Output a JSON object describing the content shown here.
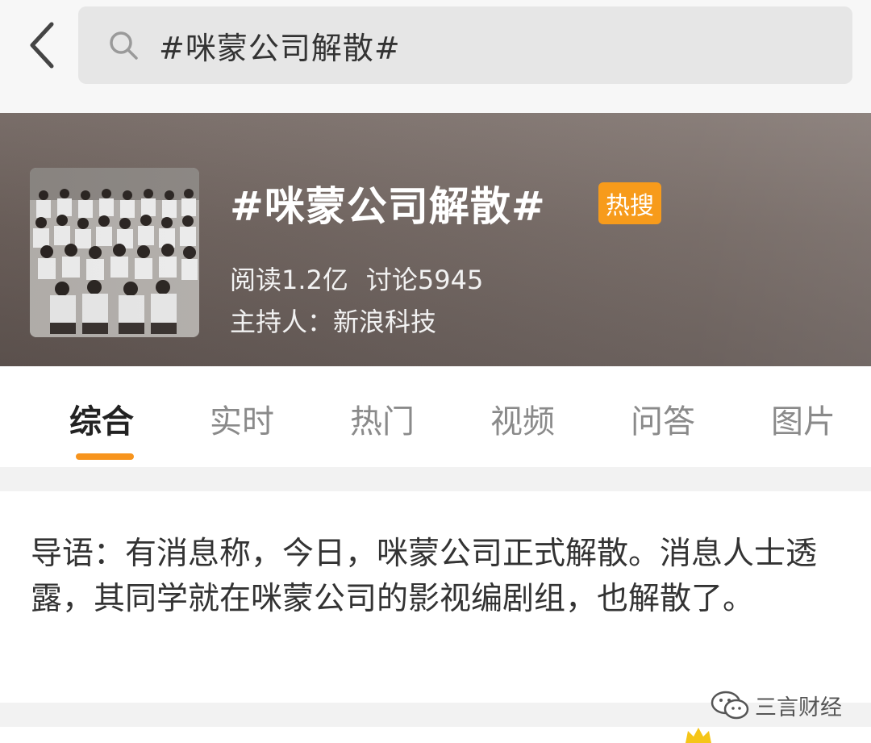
{
  "search": {
    "query": "#咪蒙公司解散#"
  },
  "topic": {
    "title": "#咪蒙公司解散#",
    "badge": "热搜",
    "reads": "阅读1.2亿",
    "discussions": "讨论5945",
    "host": "主持人：新浪科技"
  },
  "tabs": [
    {
      "label": "综合",
      "active": true
    },
    {
      "label": "实时"
    },
    {
      "label": "热门"
    },
    {
      "label": "视频"
    },
    {
      "label": "问答"
    },
    {
      "label": "图片"
    }
  ],
  "lead": {
    "text": "导语：有消息称，今日，咪蒙公司正式解散。消息人士透露，其同学就在咪蒙公司的影视编剧组，也解散了。"
  },
  "watermark": {
    "text": "三言财经"
  },
  "colors": {
    "accent": "#f7941d",
    "badge": "#f79b1b",
    "hero_bg": "#6e625d"
  },
  "icons": [
    "back-arrow-icon",
    "search-icon",
    "wechat-icon",
    "crown-icon"
  ]
}
